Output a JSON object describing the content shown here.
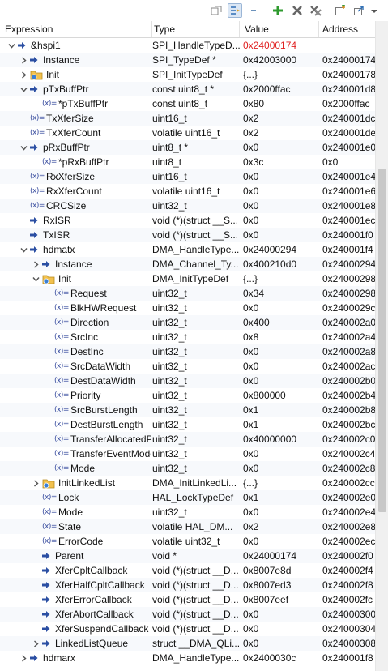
{
  "columns": {
    "expression": "Expression",
    "type": "Type",
    "value": "Value",
    "address": "Address"
  },
  "toolbar": [
    {
      "name": "show-type-names-icon"
    },
    {
      "name": "link-with-editor-icon",
      "pressed": true
    },
    {
      "name": "collapse-all-icon"
    },
    {
      "name": "add-expression-icon"
    },
    {
      "name": "remove-expression-icon"
    },
    {
      "name": "remove-all-icon"
    },
    {
      "name": "new-expression-icon"
    },
    {
      "name": "export-icon"
    },
    {
      "name": "view-menu-icon"
    }
  ],
  "rows": [
    {
      "d": 0,
      "tw": "open",
      "icon": "ptr",
      "expr": "&hspi1",
      "type": "SPI_HandleTypeD...",
      "value": "0x24000174",
      "valueChanged": true,
      "address": ""
    },
    {
      "d": 1,
      "tw": "closed",
      "icon": "ptr",
      "expr": "Instance",
      "type": "SPI_TypeDef *",
      "value": "0x42003000",
      "address": "0x24000174"
    },
    {
      "d": 1,
      "tw": "closed",
      "icon": "struct",
      "expr": "Init",
      "type": "SPI_InitTypeDef",
      "value": "{...}",
      "address": "0x24000178"
    },
    {
      "d": 1,
      "tw": "open",
      "icon": "ptr",
      "expr": "pTxBuffPtr",
      "type": "const uint8_t *",
      "value": "0x2000ffac",
      "address": "0x240001d8"
    },
    {
      "d": 2,
      "tw": "",
      "icon": "var",
      "expr": "*pTxBuffPtr",
      "type": "const uint8_t",
      "value": "0x80",
      "address": "0x2000ffac"
    },
    {
      "d": 1,
      "tw": "",
      "icon": "var",
      "expr": "TxXferSize",
      "type": "uint16_t",
      "value": "0x2",
      "address": "0x240001dc"
    },
    {
      "d": 1,
      "tw": "",
      "icon": "var",
      "expr": "TxXferCount",
      "type": "volatile uint16_t",
      "value": "0x2",
      "address": "0x240001de"
    },
    {
      "d": 1,
      "tw": "open",
      "icon": "ptr",
      "expr": "pRxBuffPtr",
      "type": "uint8_t *",
      "value": "0x0",
      "address": "0x240001e0"
    },
    {
      "d": 2,
      "tw": "",
      "icon": "var",
      "expr": "*pRxBuffPtr",
      "type": "uint8_t",
      "value": "0x3c",
      "address": "0x0"
    },
    {
      "d": 1,
      "tw": "",
      "icon": "var",
      "expr": "RxXferSize",
      "type": "uint16_t",
      "value": "0x0",
      "address": "0x240001e4"
    },
    {
      "d": 1,
      "tw": "",
      "icon": "var",
      "expr": "RxXferCount",
      "type": "volatile uint16_t",
      "value": "0x0",
      "address": "0x240001e6"
    },
    {
      "d": 1,
      "tw": "",
      "icon": "var",
      "expr": "CRCSize",
      "type": "uint32_t",
      "value": "0x0",
      "address": "0x240001e8"
    },
    {
      "d": 1,
      "tw": "",
      "icon": "ptr",
      "expr": "RxISR",
      "type": "void (*)(struct __S...",
      "value": "0x0",
      "address": "0x240001ec"
    },
    {
      "d": 1,
      "tw": "",
      "icon": "ptr",
      "expr": "TxISR",
      "type": "void (*)(struct __S...",
      "value": "0x0",
      "address": "0x240001f0"
    },
    {
      "d": 1,
      "tw": "open",
      "icon": "ptr",
      "expr": "hdmatx",
      "type": "DMA_HandleType...",
      "value": "0x24000294",
      "address": "0x240001f4"
    },
    {
      "d": 2,
      "tw": "closed",
      "icon": "ptr",
      "expr": "Instance",
      "type": "DMA_Channel_Ty...",
      "value": "0x400210d0",
      "address": "0x24000294"
    },
    {
      "d": 2,
      "tw": "open",
      "icon": "struct",
      "expr": "Init",
      "type": "DMA_InitTypeDef",
      "value": "{...}",
      "address": "0x24000298"
    },
    {
      "d": 3,
      "tw": "",
      "icon": "var",
      "expr": "Request",
      "type": "uint32_t",
      "value": "0x34",
      "address": "0x24000298"
    },
    {
      "d": 3,
      "tw": "",
      "icon": "var",
      "expr": "BlkHWRequest",
      "type": "uint32_t",
      "value": "0x0",
      "address": "0x2400029c"
    },
    {
      "d": 3,
      "tw": "",
      "icon": "var",
      "expr": "Direction",
      "type": "uint32_t",
      "value": "0x400",
      "address": "0x240002a0"
    },
    {
      "d": 3,
      "tw": "",
      "icon": "var",
      "expr": "SrcInc",
      "type": "uint32_t",
      "value": "0x8",
      "address": "0x240002a4"
    },
    {
      "d": 3,
      "tw": "",
      "icon": "var",
      "expr": "DestInc",
      "type": "uint32_t",
      "value": "0x0",
      "address": "0x240002a8"
    },
    {
      "d": 3,
      "tw": "",
      "icon": "var",
      "expr": "SrcDataWidth",
      "type": "uint32_t",
      "value": "0x0",
      "address": "0x240002ac"
    },
    {
      "d": 3,
      "tw": "",
      "icon": "var",
      "expr": "DestDataWidth",
      "type": "uint32_t",
      "value": "0x0",
      "address": "0x240002b0"
    },
    {
      "d": 3,
      "tw": "",
      "icon": "var",
      "expr": "Priority",
      "type": "uint32_t",
      "value": "0x800000",
      "address": "0x240002b4"
    },
    {
      "d": 3,
      "tw": "",
      "icon": "var",
      "expr": "SrcBurstLength",
      "type": "uint32_t",
      "value": "0x1",
      "address": "0x240002b8"
    },
    {
      "d": 3,
      "tw": "",
      "icon": "var",
      "expr": "DestBurstLength",
      "type": "uint32_t",
      "value": "0x1",
      "address": "0x240002bc"
    },
    {
      "d": 3,
      "tw": "",
      "icon": "var",
      "expr": "TransferAllocatedPort",
      "type": "uint32_t",
      "value": "0x40000000",
      "address": "0x240002c0"
    },
    {
      "d": 3,
      "tw": "",
      "icon": "var",
      "expr": "TransferEventMode",
      "type": "uint32_t",
      "value": "0x0",
      "address": "0x240002c4"
    },
    {
      "d": 3,
      "tw": "",
      "icon": "var",
      "expr": "Mode",
      "type": "uint32_t",
      "value": "0x0",
      "address": "0x240002c8"
    },
    {
      "d": 2,
      "tw": "closed",
      "icon": "struct",
      "expr": "InitLinkedList",
      "type": "DMA_InitLinkedLi...",
      "value": "{...}",
      "address": "0x240002cc"
    },
    {
      "d": 2,
      "tw": "",
      "icon": "var",
      "expr": "Lock",
      "type": "HAL_LockTypeDef",
      "value": "0x1",
      "address": "0x240002e0"
    },
    {
      "d": 2,
      "tw": "",
      "icon": "var",
      "expr": "Mode",
      "type": "uint32_t",
      "value": "0x0",
      "address": "0x240002e4"
    },
    {
      "d": 2,
      "tw": "",
      "icon": "var",
      "expr": "State",
      "type": "volatile HAL_DM...",
      "value": "0x2",
      "address": "0x240002e8"
    },
    {
      "d": 2,
      "tw": "",
      "icon": "var",
      "expr": "ErrorCode",
      "type": "volatile uint32_t",
      "value": "0x0",
      "address": "0x240002ec"
    },
    {
      "d": 2,
      "tw": "",
      "icon": "ptr",
      "expr": "Parent",
      "type": "void *",
      "value": "0x24000174",
      "address": "0x240002f0"
    },
    {
      "d": 2,
      "tw": "",
      "icon": "ptr",
      "expr": "XferCpltCallback",
      "type": "void (*)(struct __D...",
      "value": "0x8007e8d",
      "address": "0x240002f4"
    },
    {
      "d": 2,
      "tw": "",
      "icon": "ptr",
      "expr": "XferHalfCpltCallback",
      "type": "void (*)(struct __D...",
      "value": "0x8007ed3",
      "address": "0x240002f8"
    },
    {
      "d": 2,
      "tw": "",
      "icon": "ptr",
      "expr": "XferErrorCallback",
      "type": "void (*)(struct __D...",
      "value": "0x8007eef",
      "address": "0x240002fc"
    },
    {
      "d": 2,
      "tw": "",
      "icon": "ptr",
      "expr": "XferAbortCallback",
      "type": "void (*)(struct __D...",
      "value": "0x0",
      "address": "0x24000300"
    },
    {
      "d": 2,
      "tw": "",
      "icon": "ptr",
      "expr": "XferSuspendCallback",
      "type": "void (*)(struct __D...",
      "value": "0x0",
      "address": "0x24000304"
    },
    {
      "d": 2,
      "tw": "closed",
      "icon": "ptr",
      "expr": "LinkedListQueue",
      "type": "struct __DMA_QLi...",
      "value": "0x0",
      "address": "0x24000308"
    },
    {
      "d": 1,
      "tw": "closed",
      "icon": "ptr",
      "expr": "hdmarx",
      "type": "DMA_HandleType...",
      "value": "0x2400030c",
      "address": "0x240001f8"
    }
  ]
}
